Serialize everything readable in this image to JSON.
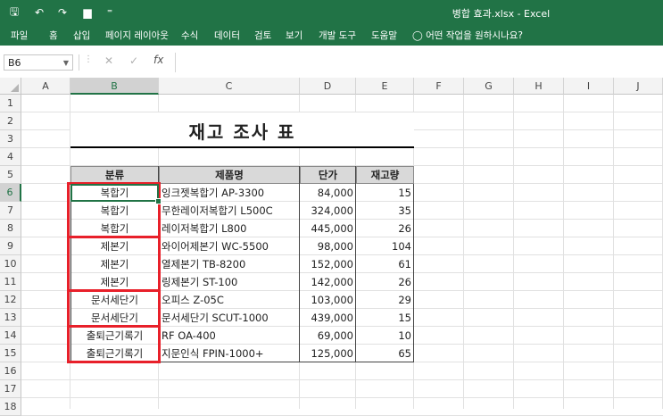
{
  "titlebar": {
    "document_title": "병합 효과.xlsx  -  Excel",
    "qat": [
      {
        "name": "save-icon",
        "glyph": "🖫"
      },
      {
        "name": "undo-icon",
        "glyph": "↶"
      },
      {
        "name": "redo-icon",
        "glyph": "↷"
      },
      {
        "name": "open-folder-icon",
        "glyph": "▆"
      },
      {
        "name": "customize-qat-icon",
        "glyph": "⁼"
      }
    ]
  },
  "ribbon": {
    "tabs": [
      "파일",
      "홈",
      "삽입",
      "페이지 레이아웃",
      "수식",
      "데이터",
      "검토",
      "보기",
      "개발 도구",
      "도움말"
    ],
    "tell_me": "어떤 작업을 원하시나요?",
    "tell_me_icon": "lightbulb-icon"
  },
  "formula_bar": {
    "name_box": "B6",
    "cancel_glyph": "✕",
    "enter_glyph": "✓",
    "fx": "fx",
    "formula": ""
  },
  "columns": [
    "A",
    "B",
    "C",
    "D",
    "E",
    "F",
    "G",
    "H",
    "I",
    "J"
  ],
  "selected_column": "B",
  "rows": [
    "1",
    "2",
    "3",
    "4",
    "5",
    "6",
    "7",
    "8",
    "9",
    "10",
    "11",
    "12",
    "13",
    "14",
    "15",
    "16",
    "17",
    "18"
  ],
  "selected_row": "6",
  "sheet": {
    "title": "재고 조사 표",
    "headers": [
      "분류",
      "제품명",
      "단가",
      "재고량"
    ],
    "data": [
      [
        "복합기",
        "잉크젯복합기 AP-3300",
        "84,000",
        "15"
      ],
      [
        "복합기",
        "무한레이저복합기 L500C",
        "324,000",
        "35"
      ],
      [
        "복합기",
        "레이저복합기 L800",
        "445,000",
        "26"
      ],
      [
        "제본기",
        "와이어제본기 WC-5500",
        "98,000",
        "104"
      ],
      [
        "제본기",
        "열제본기 TB-8200",
        "152,000",
        "61"
      ],
      [
        "제본기",
        "링제본기 ST-100",
        "142,000",
        "26"
      ],
      [
        "문서세단기",
        "오피스 Z-05C",
        "103,000",
        "29"
      ],
      [
        "문서세단기",
        "문서세단기 SCUT-1000",
        "439,000",
        "15"
      ],
      [
        "출퇴근기록기",
        "RF OA-400",
        "69,000",
        "10"
      ],
      [
        "출퇴근기록기",
        "지문인식 FPIN-1000+",
        "125,000",
        "65"
      ]
    ]
  },
  "colors": {
    "excel_green": "#217346",
    "highlight_red": "#e8202a",
    "header_fill": "#d9d9d9"
  }
}
